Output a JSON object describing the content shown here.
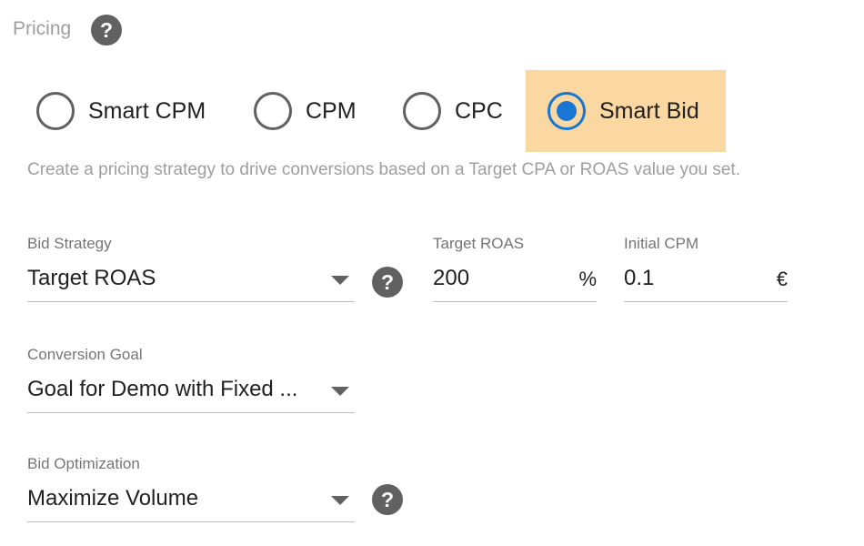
{
  "pricing": {
    "title": "Pricing",
    "help_icon": "question-mark-icon",
    "options": [
      {
        "label": "Smart CPM",
        "selected": false
      },
      {
        "label": "CPM",
        "selected": false
      },
      {
        "label": "CPC",
        "selected": false
      },
      {
        "label": "Smart Bid",
        "selected": true
      }
    ],
    "description": "Create a pricing strategy to drive conversions based on a Target CPA or ROAS value you set."
  },
  "bid_strategy": {
    "label": "Bid Strategy",
    "value": "Target ROAS"
  },
  "target_roas": {
    "label": "Target ROAS",
    "value": "200",
    "suffix": "%"
  },
  "initial_cpm": {
    "label": "Initial CPM",
    "value": "0.1",
    "suffix": "€"
  },
  "conversion_goal": {
    "label": "Conversion Goal",
    "value": "Goal for Demo with Fixed ..."
  },
  "bid_optimization": {
    "label": "Bid Optimization",
    "value": "Maximize Volume"
  },
  "colors": {
    "selected_highlight": "#fbd8a1",
    "radio_selected": "#1976d2",
    "help_icon_bg": "#616161",
    "muted_text": "#9e9e9e"
  }
}
